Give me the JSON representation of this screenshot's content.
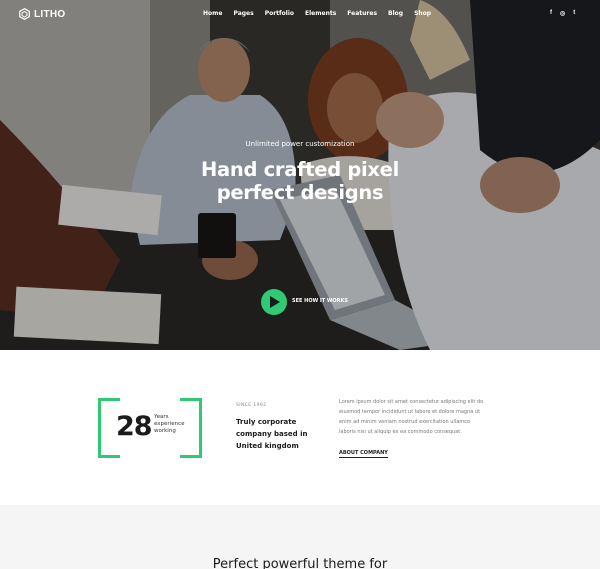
{
  "header": {
    "logo_text": "LITHO",
    "nav": [
      "Home",
      "Pages",
      "Portfolio",
      "Elements",
      "Features",
      "Blog",
      "Shop"
    ],
    "social": [
      "f",
      "◎",
      "t"
    ]
  },
  "hero": {
    "eyebrow": "Unlimited power customization",
    "title_line1": "Hand crafted pixel",
    "title_line2": "perfect designs",
    "cta_label": "SEE HOW IT WORKS"
  },
  "about": {
    "stat_number": "28",
    "stat_label_1": "Years",
    "stat_label_2": "experience",
    "stat_label_3": "working",
    "since": "SINCE 1992",
    "heading_1": "Truly corporate",
    "heading_2": "company based in",
    "heading_3": "United kingdom",
    "lorem": "Lorem ipsum dolor sit amet consectetur adipiscing elit do eiusmod tempor incididunt ut labore et dolore magna ut enim ad minim veniam nostrud exercitation ullamco laboris nisi ut aliquip ex ea commodo consequat.",
    "link_label": "ABOUT COMPANY"
  },
  "features": {
    "title": "Perfect powerful theme for"
  },
  "colors": {
    "accent": "#2fca73",
    "text_dark": "#1b1b1b",
    "muted": "#777777"
  }
}
